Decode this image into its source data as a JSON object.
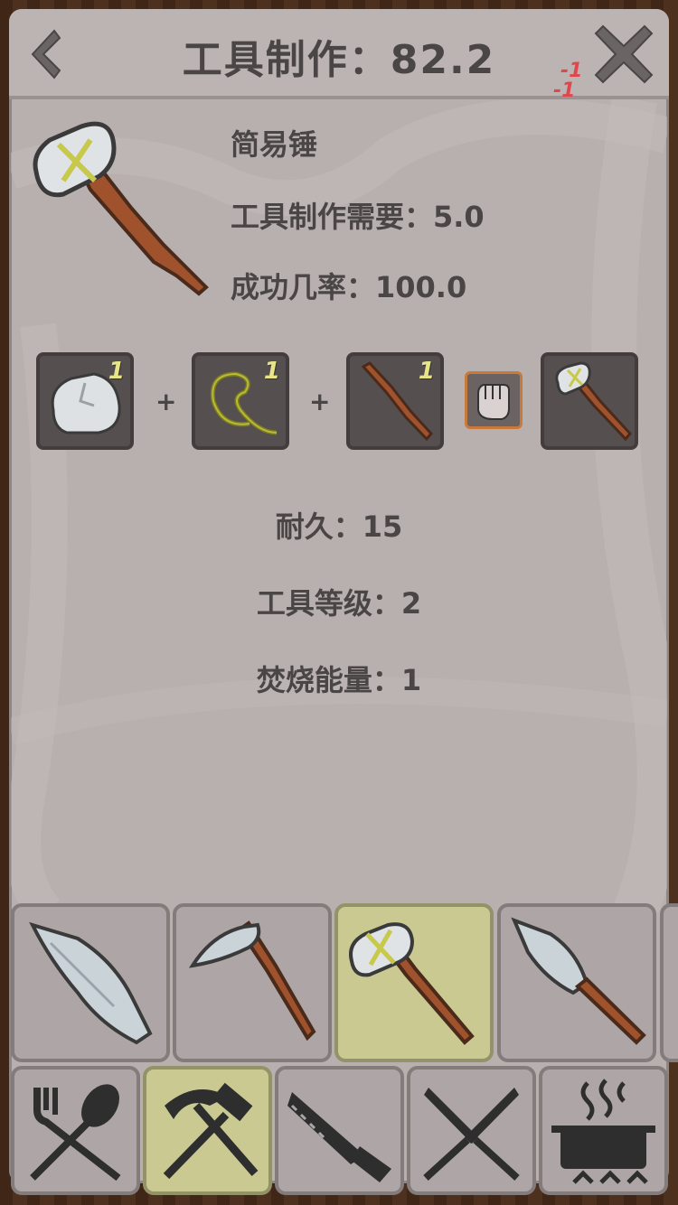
{
  "header": {
    "title": "工具制作：82.2",
    "penalty_top": "-1",
    "penalty_bottom": "-1"
  },
  "item": {
    "name": "简易锤",
    "requirement": "工具制作需要：5.0",
    "success_rate": "成功几率：100.0"
  },
  "recipe": {
    "ingredients": [
      {
        "icon": "stone-icon",
        "qty": "1"
      },
      {
        "icon": "vine-rope-icon",
        "qty": "1"
      },
      {
        "icon": "stick-icon",
        "qty": "1"
      }
    ],
    "plus": "+",
    "craft_method_icon": "fist-icon",
    "result_icon": "stone-hammer-icon"
  },
  "stats": {
    "durability": "耐久：15",
    "tool_level": "工具等级：2",
    "burn_energy": "焚烧能量：1"
  },
  "recipe_tabs": [
    {
      "icon": "sharp-stone-icon",
      "selected": false
    },
    {
      "icon": "stone-axe-icon",
      "selected": false
    },
    {
      "icon": "stone-hammer-icon",
      "selected": true
    },
    {
      "icon": "stone-spear-icon",
      "selected": false
    }
  ],
  "category_tabs": [
    {
      "icon": "fork-spoon-icon",
      "selected": false
    },
    {
      "icon": "pickaxe-hammer-icon",
      "selected": true
    },
    {
      "icon": "saw-icon",
      "selected": false
    },
    {
      "icon": "crossed-knives-icon",
      "selected": false
    },
    {
      "icon": "cooking-pot-icon",
      "selected": false
    }
  ],
  "colors": {
    "panel": "#b8b0ae",
    "text": "#4a4646",
    "selected_tab": "#c9c991",
    "penalty": "#e0474c",
    "qty": "#e8e48a"
  }
}
